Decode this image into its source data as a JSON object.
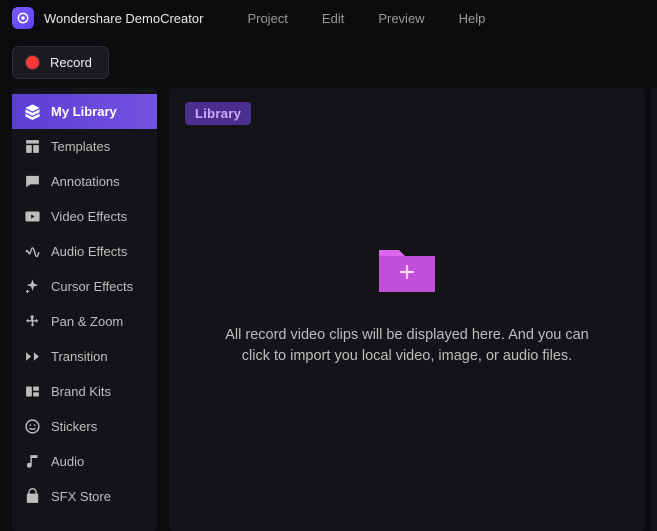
{
  "app": {
    "title": "Wondershare DemoCreator"
  },
  "menu": {
    "items": [
      "Project",
      "Edit",
      "Preview",
      "Help"
    ]
  },
  "toolbar": {
    "record_label": "Record"
  },
  "sidebar": {
    "items": [
      {
        "label": "My Library",
        "icon": "layers",
        "active": true
      },
      {
        "label": "Templates",
        "icon": "template",
        "active": false
      },
      {
        "label": "Annotations",
        "icon": "annotation",
        "active": false
      },
      {
        "label": "Video Effects",
        "icon": "video",
        "active": false
      },
      {
        "label": "Audio Effects",
        "icon": "audio-wave",
        "active": false
      },
      {
        "label": "Cursor Effects",
        "icon": "cursor-sparkle",
        "active": false
      },
      {
        "label": "Pan & Zoom",
        "icon": "pan-zoom",
        "active": false
      },
      {
        "label": "Transition",
        "icon": "transition",
        "active": false
      },
      {
        "label": "Brand Kits",
        "icon": "brand-kit",
        "active": false
      },
      {
        "label": "Stickers",
        "icon": "sticker",
        "active": false
      },
      {
        "label": "Audio",
        "icon": "music-note",
        "active": false
      },
      {
        "label": "SFX Store",
        "icon": "sfx-bag",
        "active": false
      }
    ]
  },
  "content": {
    "tag_label": "Library",
    "empty_message": "All record video clips will be displayed here. And you can click to import you local video, image, or audio files."
  },
  "colors": {
    "accent": "#7352e0",
    "folder": "#c24fd8",
    "record": "#ff3838"
  }
}
